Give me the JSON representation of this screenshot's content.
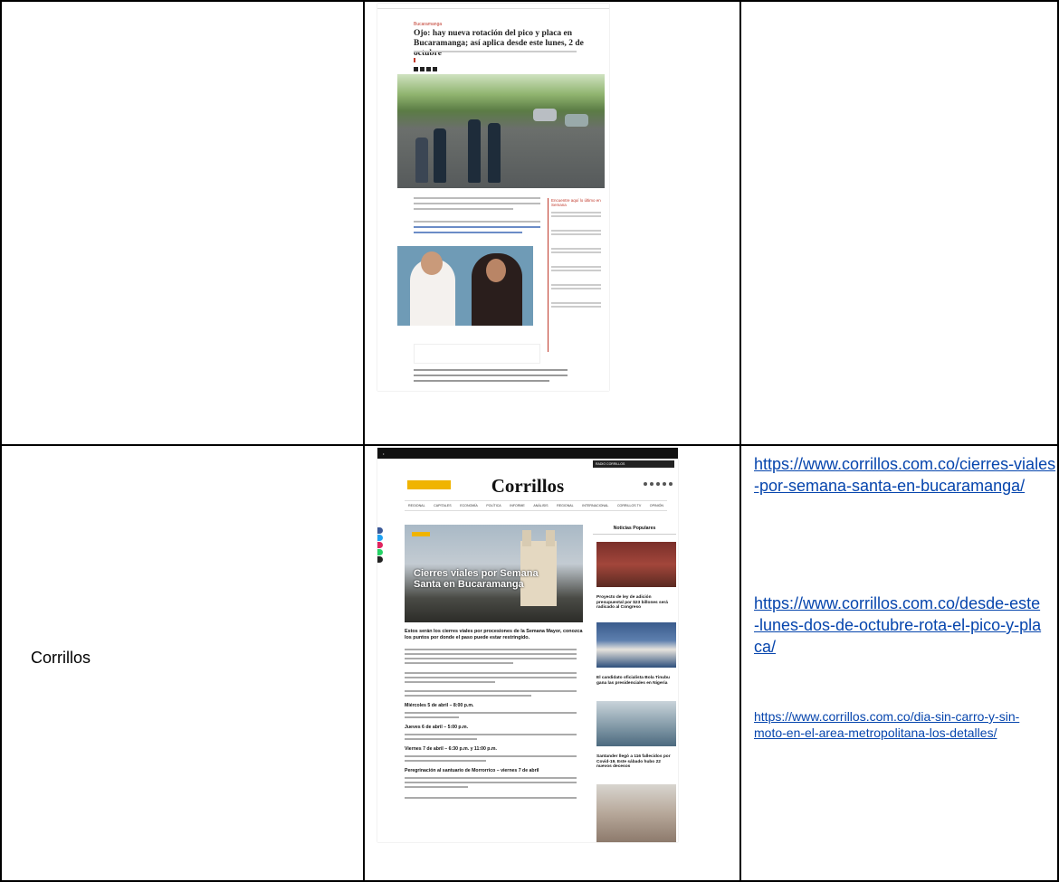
{
  "rows": [
    {
      "source_name": "",
      "links": []
    },
    {
      "source_name": "Corrillos",
      "links": [
        "https://www.corrillos.com.co/cierres-viales-por-semana-santa-en-bucaramanga/",
        "https://www.corrillos.com.co/desde-este-lunes-dos-de-octubre-rota-el-pico-y-placa/",
        "https://www.corrillos.com.co/dia-sin-carro-y-sin-moto-en-el-area-metropolitana-los-detalles/"
      ]
    }
  ],
  "screenshot_vanguardia": {
    "section": "Bucaramanga",
    "headline": "Ojo: hay nueva rotación del pico y placa en Bucaramanga; así aplica desde este lunes, 2 de octubre",
    "sidebar_title": "Encuentre aquí lo último en Semana"
  },
  "screenshot_corrillos": {
    "logo": "Corrillos",
    "radio": "RADIO CORRILLOS",
    "hero_title": "Cierres viales por Semana Santa en Bucaramanga",
    "lead": "Estos serán los cierres viales por procesiones de la Semana Mayor, conozca los puntos por donde el paso puede estar restringido.",
    "subheads": [
      "Miércoles 5 de abril – 8:00 p.m.",
      "Jueves 6 de abril – 5:00 p.m.",
      "Viernes 7 de abril – 6:30 p.m. y 11:00 p.m.",
      "Peregrinación al santuario de Morrorrico – viernes 7 de abril"
    ],
    "popular_heading": "Noticias Populares",
    "popular": [
      {
        "title": "Proyecto de ley de adición presupuestal por $23 billones será radicado al Congreso"
      },
      {
        "title": "El candidato oficialista Bola Tinubu gana las presidenciales en Nigeria"
      },
      {
        "title": "Santander llegó a 116 fallecidos por Covid-19. Este sábado hubo 22 nuevos decesos"
      }
    ],
    "nav": [
      "REGIONAL",
      "CAPITALES",
      "ECONOMÍA",
      "POLÍTICA",
      "INFORME",
      "ANÁLISIS",
      "REGIONAL",
      "INTERNACIONAL",
      "CORRILLOS TV",
      "OPINIÓN"
    ]
  },
  "colors": {
    "link": "#0645ad",
    "border": "#000000",
    "corrillos_accent": "#f0b400",
    "vanguardia_accent": "#c0392b"
  }
}
